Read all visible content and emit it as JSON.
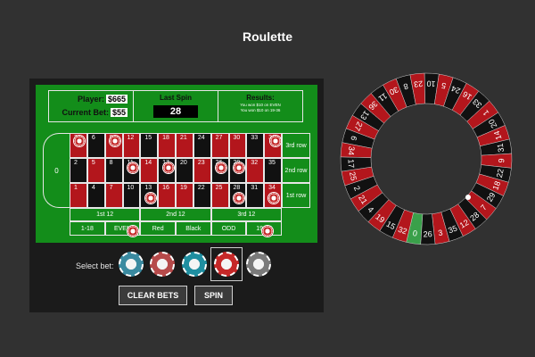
{
  "title": "Roulette",
  "info": {
    "player_label": "Player:",
    "player_value": "$665",
    "bet_label": "Current Bet:",
    "bet_value": "$55",
    "last_spin_label": "Last Spin",
    "last_spin_sub": "",
    "last_spin_value": "28",
    "results_title": "Results:",
    "results_lines": [
      "You won $10 on EVEN",
      "You won $10 on 19-36"
    ]
  },
  "table": {
    "zero": "0",
    "rows": [
      [
        "3",
        "6",
        "9",
        "12",
        "15",
        "18",
        "21",
        "24",
        "27",
        "30",
        "33",
        "36"
      ],
      [
        "2",
        "5",
        "8",
        "11",
        "14",
        "17",
        "20",
        "23",
        "26",
        "29",
        "32",
        "35"
      ],
      [
        "1",
        "4",
        "7",
        "10",
        "13",
        "16",
        "19",
        "22",
        "25",
        "28",
        "31",
        "34"
      ]
    ],
    "columns": [
      "3rd row",
      "2nd row",
      "1st row"
    ],
    "dozens": [
      "1st 12",
      "2nd 12",
      "3rd 12"
    ],
    "outside": [
      "1-18",
      "EVEN",
      "Red",
      "Black",
      "ODD",
      "19-36"
    ]
  },
  "select_label": "Select bet:",
  "chip_values": [
    "1",
    "5",
    "10",
    "25",
    "100"
  ],
  "buttons": {
    "clear": "CLEAR BETS",
    "spin": "SPIN"
  },
  "colors": {
    "felt": "#138d1a",
    "red": "#b3161c",
    "black": "#111111",
    "panel": "#1b1b1b",
    "background": "#313131"
  },
  "wheel_numbers": [
    "0",
    "32",
    "15",
    "19",
    "4",
    "21",
    "2",
    "25",
    "17",
    "34",
    "6",
    "27",
    "13",
    "36",
    "11",
    "30",
    "8",
    "23",
    "10",
    "5",
    "24",
    "16",
    "33",
    "1",
    "20",
    "14",
    "31",
    "9",
    "22",
    "18",
    "29",
    "7",
    "28",
    "12",
    "35",
    "3",
    "26"
  ]
}
